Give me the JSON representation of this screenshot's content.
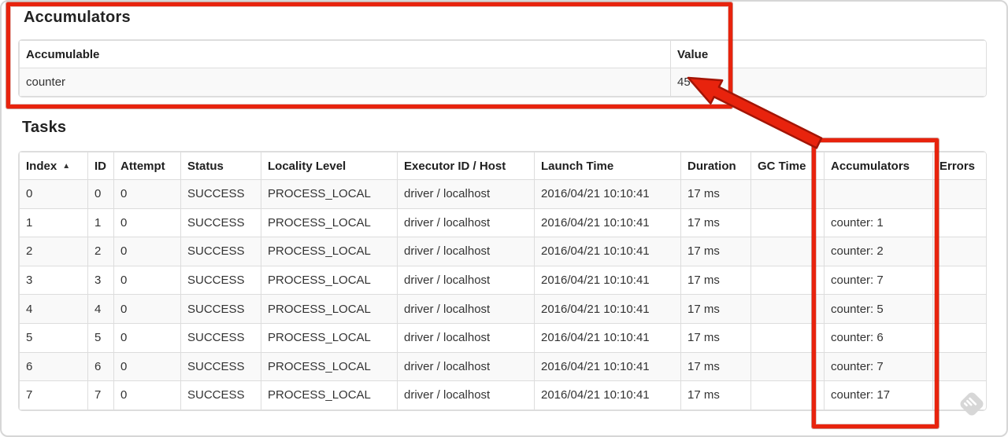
{
  "colors": {
    "annotation_red": "#e8230d",
    "annotation_red_outline": "#a31405",
    "row_stripe": "#f9f9f9",
    "table_border": "#dddddd"
  },
  "icons": {
    "sort_ascending": "▲",
    "watermark": "stamp-watermark"
  },
  "accumulators_section": {
    "title": "Accumulators",
    "table": {
      "headers": [
        "Accumulable",
        "Value"
      ],
      "rows": [
        {
          "accumulable": "counter",
          "value": "45"
        }
      ]
    }
  },
  "tasks_section": {
    "title": "Tasks",
    "table": {
      "headers": [
        "Index",
        "ID",
        "Attempt",
        "Status",
        "Locality Level",
        "Executor ID / Host",
        "Launch Time",
        "Duration",
        "GC Time",
        "Accumulators",
        "Errors"
      ],
      "rows": [
        [
          "0",
          "0",
          "0",
          "SUCCESS",
          "PROCESS_LOCAL",
          "driver / localhost",
          "2016/04/21 10:10:41",
          "17 ms",
          "",
          "",
          ""
        ],
        [
          "1",
          "1",
          "0",
          "SUCCESS",
          "PROCESS_LOCAL",
          "driver / localhost",
          "2016/04/21 10:10:41",
          "17 ms",
          "",
          "counter: 1",
          ""
        ],
        [
          "2",
          "2",
          "0",
          "SUCCESS",
          "PROCESS_LOCAL",
          "driver / localhost",
          "2016/04/21 10:10:41",
          "17 ms",
          "",
          "counter: 2",
          ""
        ],
        [
          "3",
          "3",
          "0",
          "SUCCESS",
          "PROCESS_LOCAL",
          "driver / localhost",
          "2016/04/21 10:10:41",
          "17 ms",
          "",
          "counter: 7",
          ""
        ],
        [
          "4",
          "4",
          "0",
          "SUCCESS",
          "PROCESS_LOCAL",
          "driver / localhost",
          "2016/04/21 10:10:41",
          "17 ms",
          "",
          "counter: 5",
          ""
        ],
        [
          "5",
          "5",
          "0",
          "SUCCESS",
          "PROCESS_LOCAL",
          "driver / localhost",
          "2016/04/21 10:10:41",
          "17 ms",
          "",
          "counter: 6",
          ""
        ],
        [
          "6",
          "6",
          "0",
          "SUCCESS",
          "PROCESS_LOCAL",
          "driver / localhost",
          "2016/04/21 10:10:41",
          "17 ms",
          "",
          "counter: 7",
          ""
        ],
        [
          "7",
          "7",
          "0",
          "SUCCESS",
          "PROCESS_LOCAL",
          "driver / localhost",
          "2016/04/21 10:10:41",
          "17 ms",
          "",
          "counter: 17",
          ""
        ]
      ]
    }
  }
}
